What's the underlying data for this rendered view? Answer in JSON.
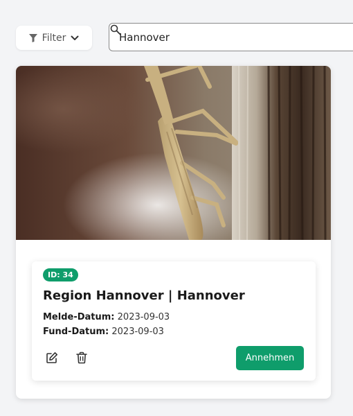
{
  "toolbar": {
    "filter_label": "Filter",
    "search_value": "Hannover"
  },
  "card": {
    "image_alt": "Praying mantis on wooden post",
    "id_badge": "ID: 34",
    "title": "Region Hannover | Hannover",
    "melde_label": "Melde-Datum:",
    "melde_value": "2023-09-03",
    "fund_label": "Fund-Datum:",
    "fund_value": "2023-09-03",
    "accept_label": "Annehmen"
  },
  "colors": {
    "accent": "#0f9d6b",
    "background": "#f3f4f6"
  },
  "icons": [
    "filter-icon",
    "chevron-down-icon",
    "search-icon",
    "edit-icon",
    "trash-icon"
  ]
}
